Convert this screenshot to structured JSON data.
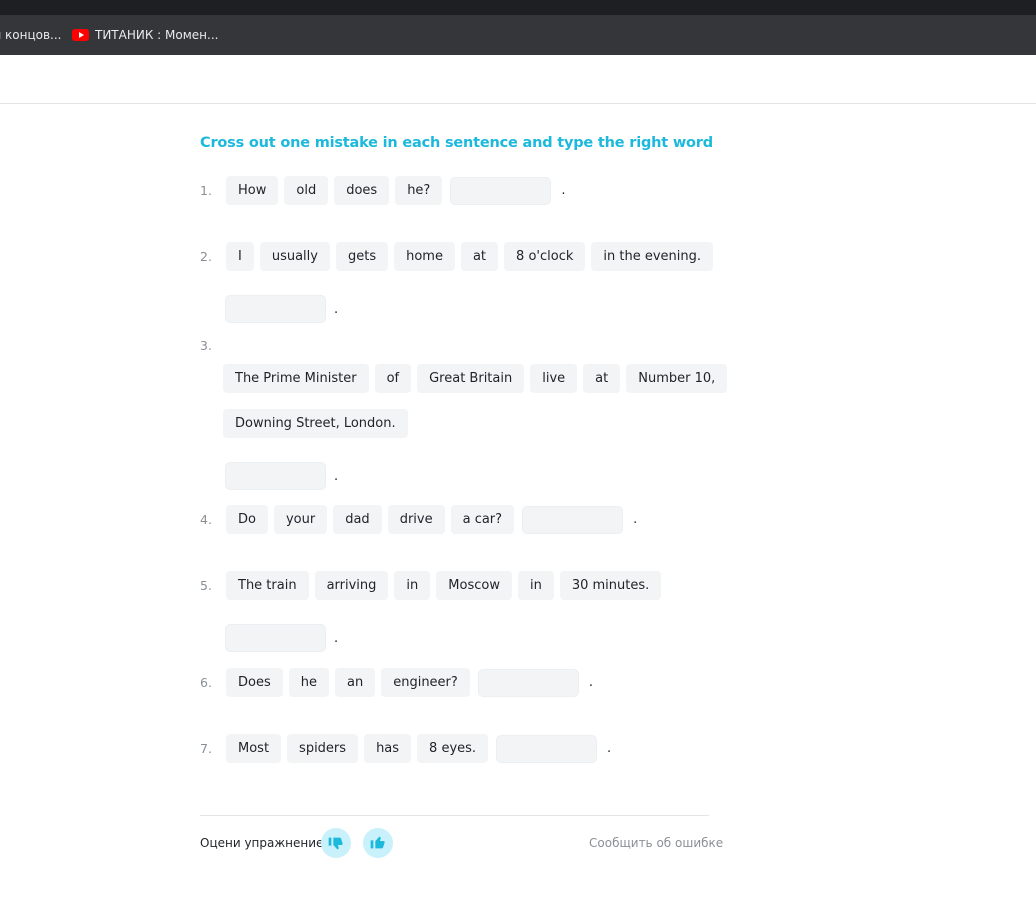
{
  "browser": {
    "bookmarks": [
      {
        "label": "я концов..."
      },
      {
        "label": "ТИТАНИК : Момен...",
        "icon": "youtube-icon"
      }
    ]
  },
  "exercise": {
    "title": "Cross out one mistake in each sentence and type the right word",
    "period": ".",
    "sentences": [
      {
        "number": "1.",
        "words": [
          "How",
          "old",
          "does",
          "he?"
        ]
      },
      {
        "number": "2.",
        "words": [
          "I",
          "usually",
          "gets",
          "home",
          "at",
          "8 o'clock",
          "in the evening."
        ]
      },
      {
        "number": "3.",
        "words": [
          "The Prime Minister",
          "of",
          "Great Britain",
          "live",
          "at",
          "Number 10,",
          "Downing Street, London."
        ]
      },
      {
        "number": "4.",
        "words": [
          "Do",
          "your",
          "dad",
          "drive",
          "a car?"
        ]
      },
      {
        "number": "5.",
        "words": [
          "The train",
          "arriving",
          "in",
          "Moscow",
          "in",
          "30 minutes."
        ]
      },
      {
        "number": "6.",
        "words": [
          "Does",
          "he",
          "an",
          "engineer?"
        ]
      },
      {
        "number": "7.",
        "words": [
          "Most",
          "spiders",
          "has",
          "8 eyes."
        ]
      }
    ]
  },
  "footer": {
    "rate_label": "Оцени упражнение",
    "dislike_icon": "thumbs-down-icon",
    "like_icon": "thumbs-up-icon",
    "report_link": "Сообщить об ошибке",
    "accent_color": "#1cb9dc"
  }
}
